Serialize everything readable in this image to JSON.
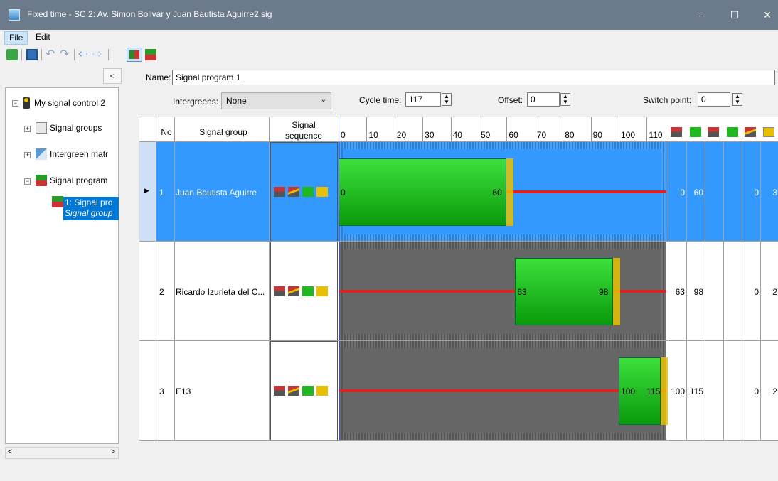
{
  "window": {
    "title": "Fixed time - SC 2: Av. Simon Bolivar y Juan Bautista Aguirre2.sig",
    "minimize": "–",
    "maximize": "☐",
    "close": "✕"
  },
  "menu": {
    "file": "File",
    "edit": "Edit"
  },
  "toolbar": {
    "icons": [
      "open-icon",
      "save-icon",
      "undo-icon",
      "redo-icon",
      "back-icon",
      "forward-icon",
      "edit-mode-icon",
      "signal-times-icon"
    ]
  },
  "tree": {
    "collapse_label": "<",
    "root": "My signal control 2",
    "items": [
      "Signal groups",
      "Intergreen matr",
      "Signal program"
    ],
    "selected_line1": "1: Signal pro",
    "selected_line2": "Signal group"
  },
  "form": {
    "name_label": "Name:",
    "name_value": "Signal program 1",
    "intergreens_label": "Intergreens:",
    "intergreens_value": "None",
    "cycle_label": "Cycle time:",
    "cycle_value": "117",
    "offset_label": "Offset:",
    "offset_value": "0",
    "switch_label": "Switch point:",
    "switch_value": "0"
  },
  "table": {
    "headers": {
      "no": "No",
      "group": "Signal group",
      "seq_line1": "Signal",
      "seq_line2": "sequence"
    },
    "ticks": [
      "0",
      "10",
      "20",
      "30",
      "40",
      "50",
      "60",
      "70",
      "80",
      "90",
      "100",
      "110"
    ],
    "rows": [
      {
        "no": "1",
        "name": "Juan Bautista Aguirre",
        "green_start": 0,
        "green_end": 60,
        "start_label": "0",
        "end_label": "60",
        "col1": "0",
        "col2": "60",
        "col3": "",
        "col4": "0",
        "col5": "3"
      },
      {
        "no": "2",
        "name": "Ricardo Izurieta del C...",
        "green_start": 63,
        "green_end": 98,
        "start_label": "63",
        "end_label": "98",
        "col1": "63",
        "col2": "98",
        "col3": "",
        "col4": "0",
        "col5": "2"
      },
      {
        "no": "3",
        "name": "E13",
        "green_start": 100,
        "green_end": 115,
        "start_label": "100",
        "end_label": "115",
        "col1": "100",
        "col2": "115",
        "col3": "",
        "col4": "0",
        "col5": "2"
      }
    ],
    "cycle": 117
  },
  "colors": {
    "selected": "#3399ff",
    "green": "#1fb81f",
    "red": "#d22",
    "amber": "#e8c000"
  }
}
